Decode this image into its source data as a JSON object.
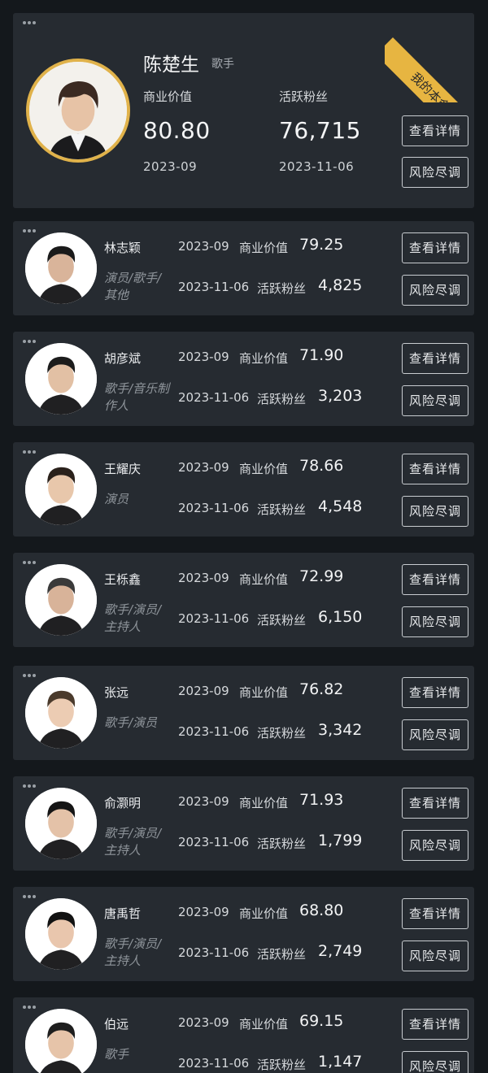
{
  "featured": {
    "name": "陈楚生",
    "tag": "歌手",
    "ribbon": "我的本命",
    "biz_label": "商业价值",
    "biz_value": "80.80",
    "biz_date": "2023-09",
    "fans_label": "活跃粉丝",
    "fans_value": "76,715",
    "fans_date": "2023-11-06",
    "btn_detail": "查看详情",
    "btn_risk": "风险尽调"
  },
  "rows": [
    {
      "name": "林志颖",
      "roles": "演员/歌手/其他",
      "date1": "2023-09",
      "label1": "商业价值",
      "value1": "79.25",
      "date2": "2023-11-06",
      "label2": "活跃粉丝",
      "value2": "4,825",
      "btn_detail": "查看详情",
      "btn_risk": "风险尽调"
    },
    {
      "name": "胡彦斌",
      "roles": "歌手/音乐制作人",
      "date1": "2023-09",
      "label1": "商业价值",
      "value1": "71.90",
      "date2": "2023-11-06",
      "label2": "活跃粉丝",
      "value2": "3,203",
      "btn_detail": "查看详情",
      "btn_risk": "风险尽调"
    },
    {
      "name": "王耀庆",
      "roles": "演员",
      "date1": "2023-09",
      "label1": "商业价值",
      "value1": "78.66",
      "date2": "2023-11-06",
      "label2": "活跃粉丝",
      "value2": "4,548",
      "btn_detail": "查看详情",
      "btn_risk": "风险尽调"
    },
    {
      "name": "王栎鑫",
      "roles": "歌手/演员/主持人",
      "date1": "2023-09",
      "label1": "商业价值",
      "value1": "72.99",
      "date2": "2023-11-06",
      "label2": "活跃粉丝",
      "value2": "6,150",
      "btn_detail": "查看详情",
      "btn_risk": "风险尽调"
    },
    {
      "name": "张远",
      "roles": "歌手/演员",
      "date1": "2023-09",
      "label1": "商业价值",
      "value1": "76.82",
      "date2": "2023-11-06",
      "label2": "活跃粉丝",
      "value2": "3,342",
      "btn_detail": "查看详情",
      "btn_risk": "风险尽调"
    },
    {
      "name": "俞灏明",
      "roles": "歌手/演员/主持人",
      "date1": "2023-09",
      "label1": "商业价值",
      "value1": "71.93",
      "date2": "2023-11-06",
      "label2": "活跃粉丝",
      "value2": "1,799",
      "btn_detail": "查看详情",
      "btn_risk": "风险尽调"
    },
    {
      "name": "唐禹哲",
      "roles": "歌手/演员/主持人",
      "date1": "2023-09",
      "label1": "商业价值",
      "value1": "68.80",
      "date2": "2023-11-06",
      "label2": "活跃粉丝",
      "value2": "2,749",
      "btn_detail": "查看详情",
      "btn_risk": "风险尽调"
    },
    {
      "name": "伯远",
      "roles": "歌手",
      "date1": "2023-09",
      "label1": "商业价值",
      "value1": "69.15",
      "date2": "2023-11-06",
      "label2": "活跃粉丝",
      "value2": "1,147",
      "btn_detail": "查看详情",
      "btn_risk": "风险尽调"
    }
  ],
  "colors": {
    "background": "#14181c",
    "card": "#262b31",
    "accent": "#e0b24a",
    "muted": "#8f959b"
  },
  "icons": {
    "menu": "more-dots-icon",
    "avatar": "avatar-photo"
  }
}
